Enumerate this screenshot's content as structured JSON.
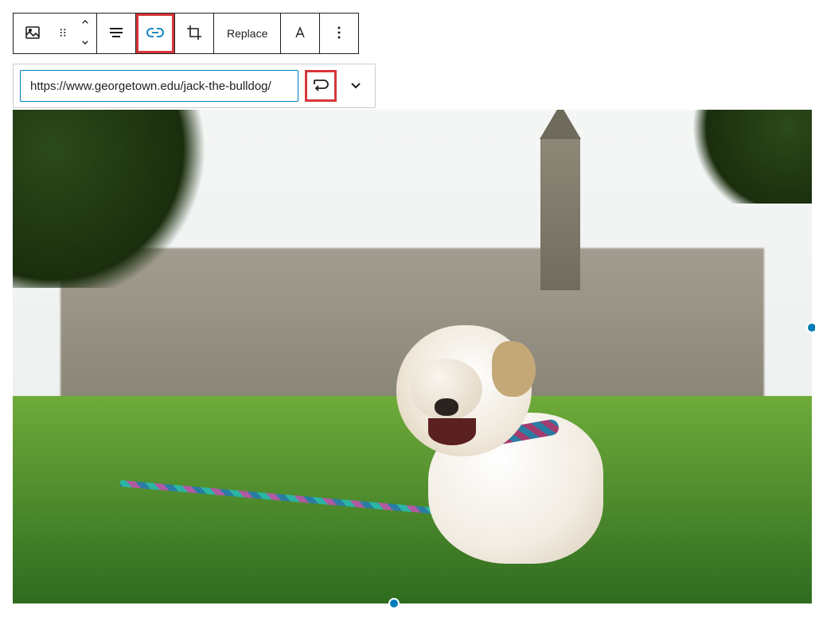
{
  "toolbar": {
    "replace_label": "Replace"
  },
  "link_popover": {
    "url_value": "https://www.georgetown.edu/jack-the-bulldog/"
  },
  "highlighted_elements": [
    "link-button",
    "submit-link-button"
  ],
  "accent_color": "#007cba",
  "highlight_color": "#d63638"
}
